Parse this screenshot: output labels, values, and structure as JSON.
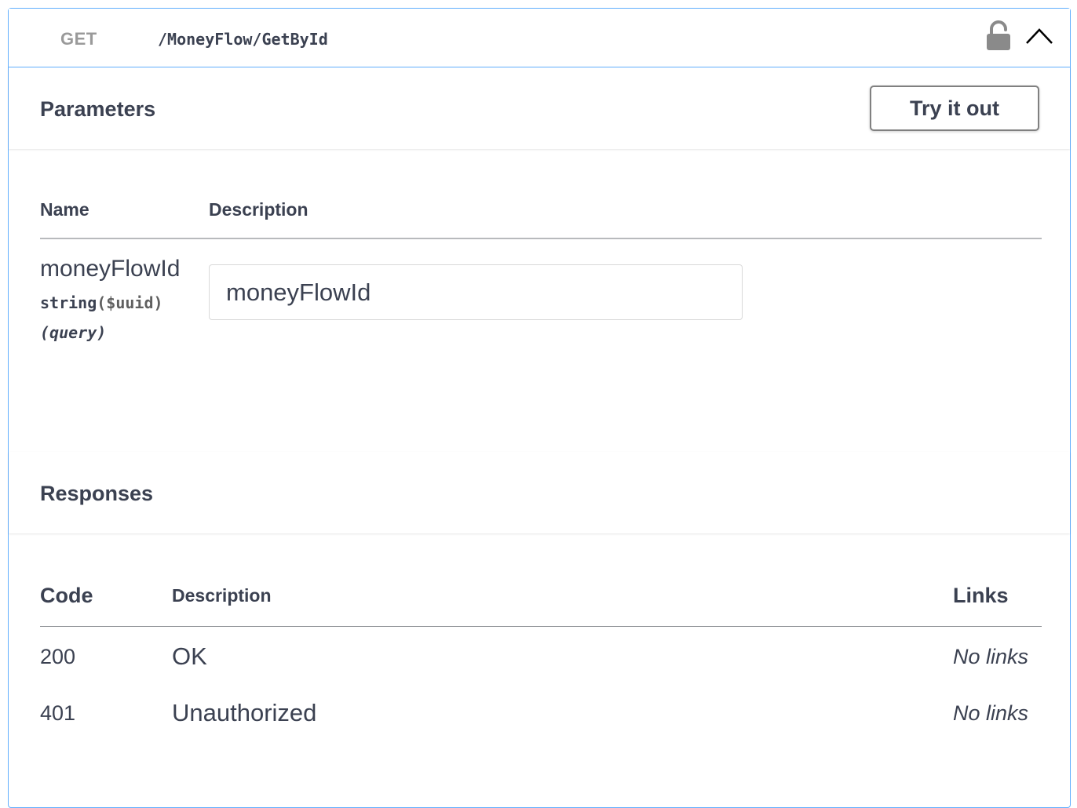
{
  "operation": {
    "method": "GET",
    "path": "/MoneyFlow/GetById",
    "accent_color": "#61affe",
    "lock_icon": "lock-open-icon",
    "collapse_icon": "chevron-up-icon"
  },
  "parameters": {
    "title": "Parameters",
    "try_label": "Try it out",
    "columns": {
      "name": "Name",
      "description": "Description"
    },
    "items": [
      {
        "name": "moneyFlowId",
        "type": "string",
        "format": "($uuid)",
        "in": "(query)",
        "placeholder": "moneyFlowId"
      }
    ]
  },
  "responses": {
    "title": "Responses",
    "columns": {
      "code": "Code",
      "description": "Description",
      "links": "Links"
    },
    "rows": [
      {
        "code": "200",
        "description": "OK",
        "links": "No links"
      },
      {
        "code": "401",
        "description": "Unauthorized",
        "links": "No links"
      }
    ]
  }
}
